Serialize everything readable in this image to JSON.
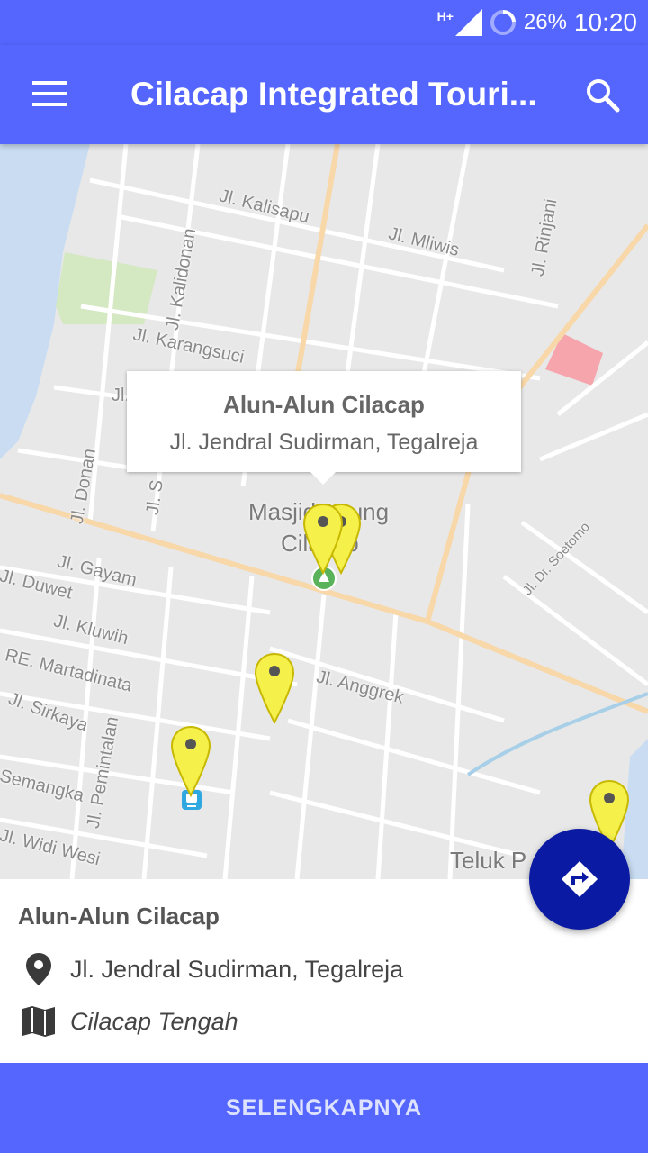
{
  "status_bar": {
    "network": "H+",
    "battery": "26%",
    "time": "10:20"
  },
  "app_bar": {
    "title": "Cilacap Integrated Touri...",
    "menu_icon": "hamburger-menu-icon",
    "search_icon": "search-icon"
  },
  "map": {
    "street_labels": [
      "Jl. Kalisapu",
      "Jl. Mliwis",
      "Jl. Rinjani",
      "Jl. Kalidonan",
      "Jl. Karangsuci",
      "Jl. Donan",
      "Jl. Gayam",
      "Jl. Duwet",
      "Jl. Kluwih",
      "RE. Martadinata",
      "Jl. Sirkaya",
      "Jl. Pemintalan",
      "Jl. Anggrek",
      "Jl. Dr. Soetomo",
      "Semangka",
      "Jl. Widi Wesi",
      "Teluk P",
      "Masjid Agung",
      "Cilacap",
      "Jl. S",
      "Jl. J"
    ],
    "info_window": {
      "title": "Alun-Alun Cilacap",
      "subtitle": "Jl. Jendral Sudirman, Tegalreja"
    },
    "pin_color": "#f5f04a"
  },
  "fab": {
    "icon": "directions-icon",
    "color": "#0a1aa3"
  },
  "details": {
    "name": "Alun-Alun Cilacap",
    "address": "Jl. Jendral Sudirman, Tegalreja",
    "address_icon": "location-pin-icon",
    "district": "Cilacap Tengah",
    "district_icon": "map-icon"
  },
  "footer_button": {
    "label": "SELENGKAPNYA"
  },
  "colors": {
    "primary": "#5566ff",
    "fab": "#0a1aa3"
  }
}
